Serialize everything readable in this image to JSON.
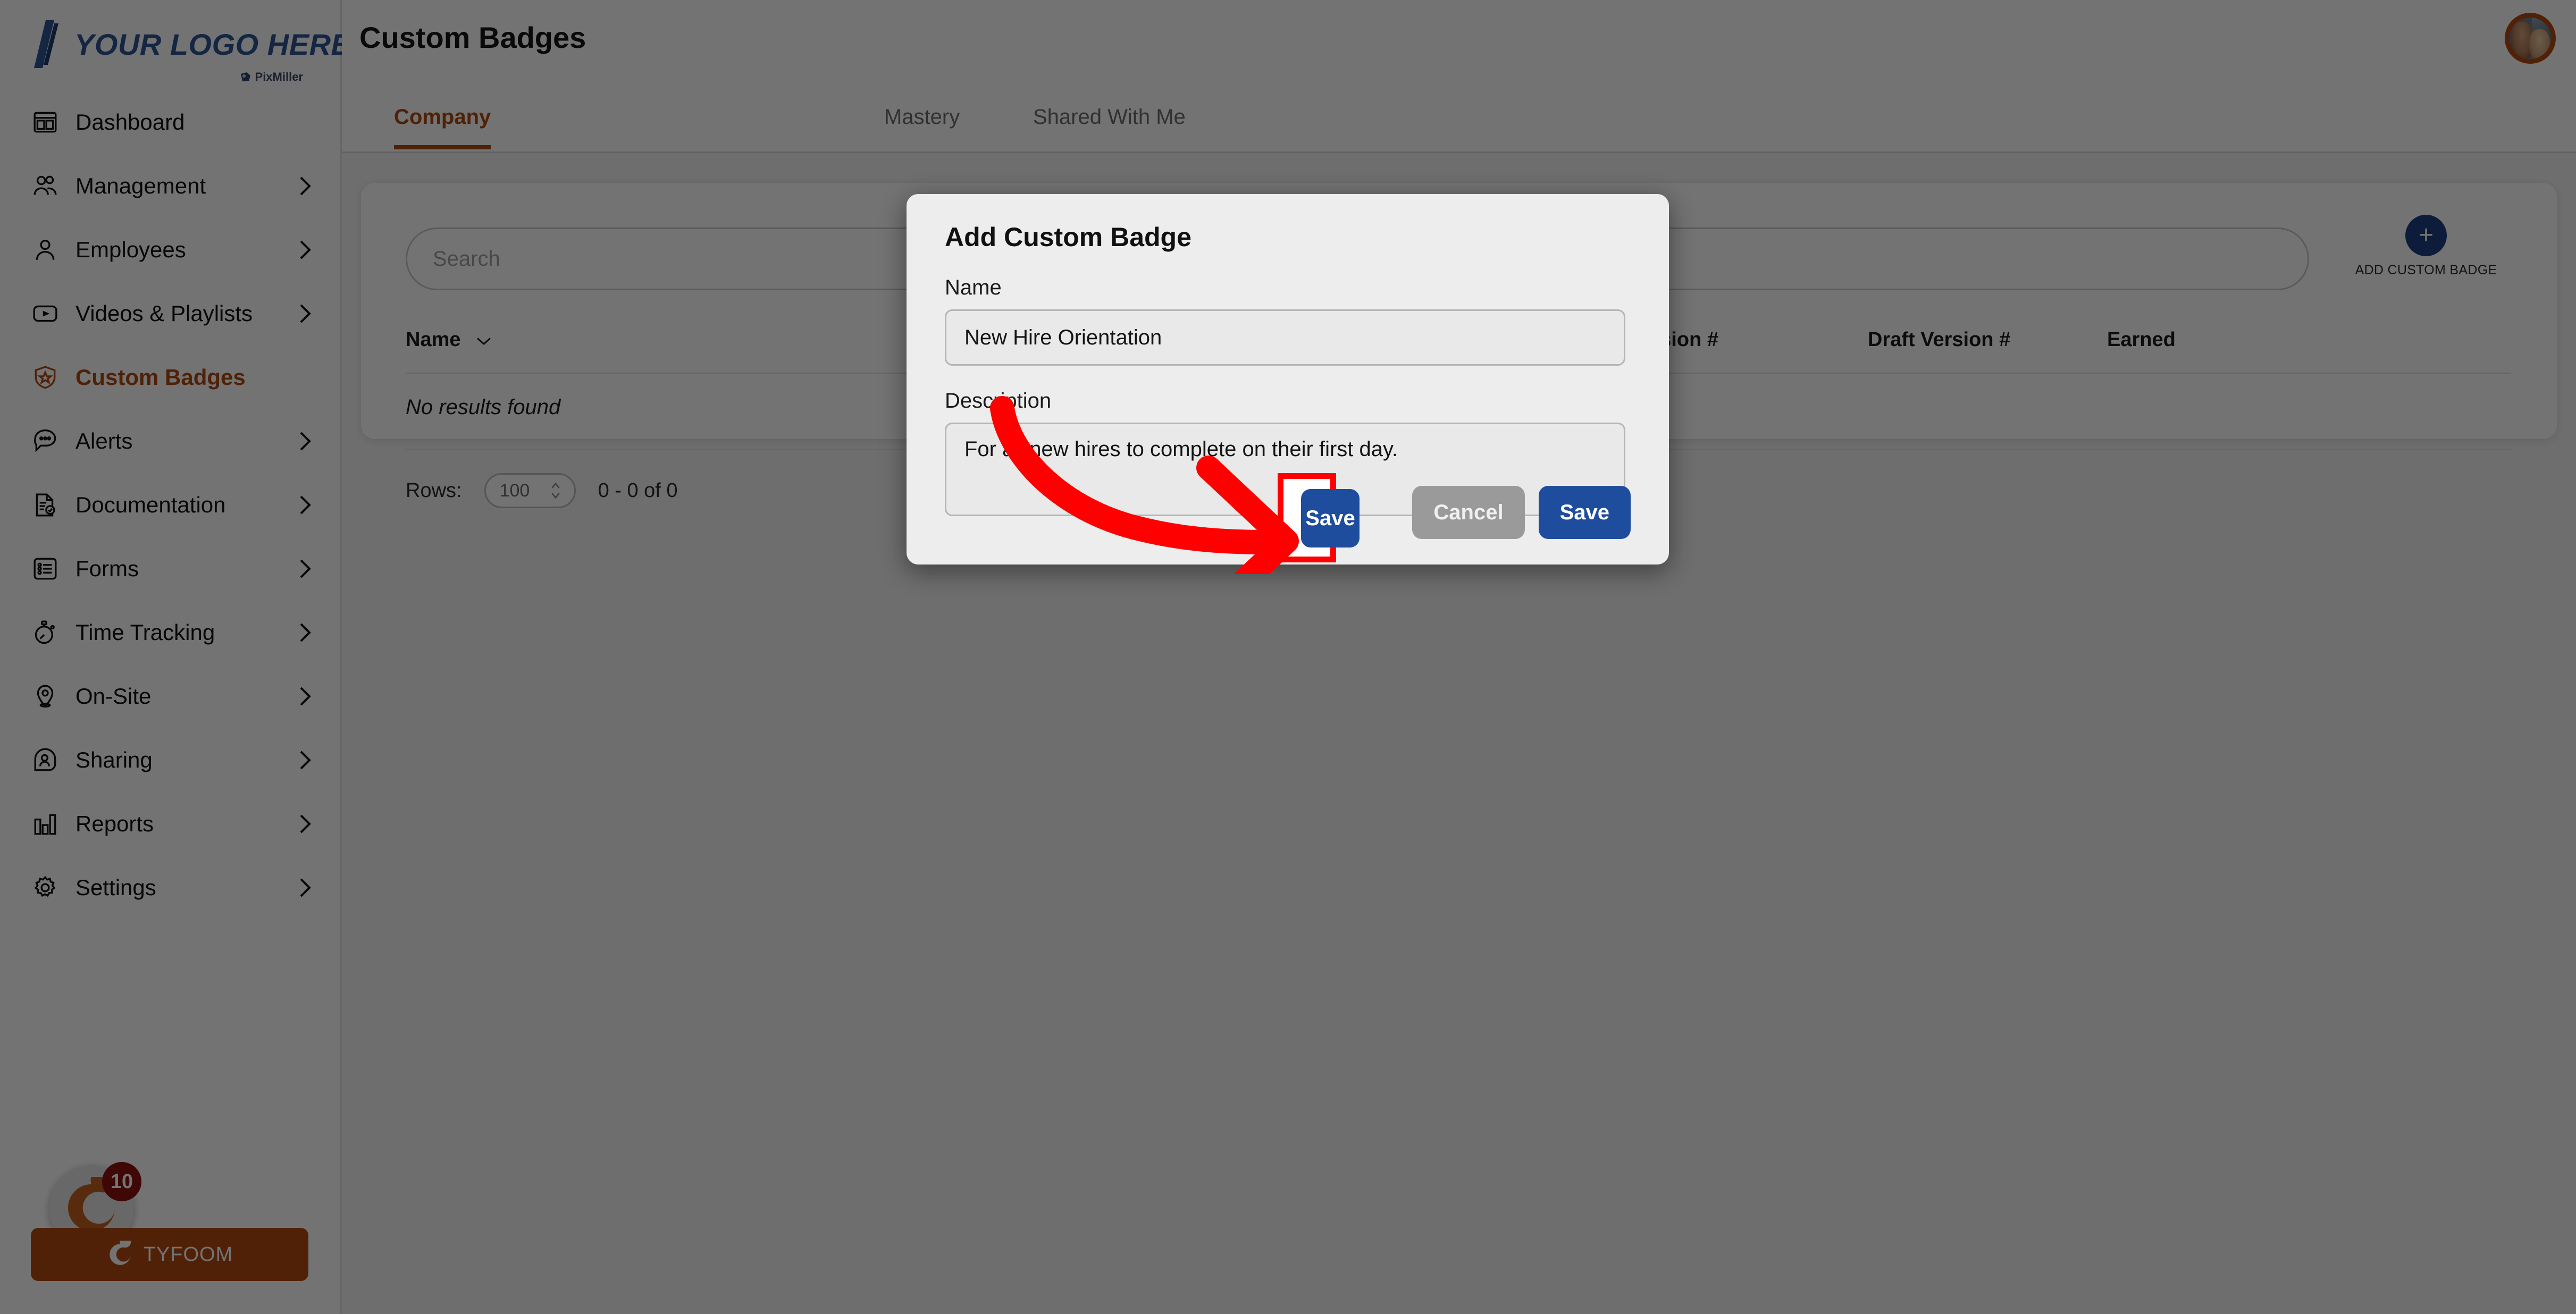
{
  "brand": {
    "logo_text": "YOUR LOGO HERE",
    "watermark": "PixMiller",
    "accent_color": "#b04a10",
    "logo_color": "#2f5596",
    "primary_button_color": "#1f4d9e",
    "highlight_color": "#ff0000"
  },
  "header": {
    "page_title": "Custom Badges"
  },
  "sidebar": {
    "items": [
      {
        "label": "Dashboard",
        "icon": "dashboard-icon",
        "has_chevron": false,
        "active": false
      },
      {
        "label": "Management",
        "icon": "people-icon",
        "has_chevron": true,
        "active": false
      },
      {
        "label": "Employees",
        "icon": "person-icon",
        "has_chevron": true,
        "active": false
      },
      {
        "label": "Videos & Playlists",
        "icon": "video-play-icon",
        "has_chevron": true,
        "active": false
      },
      {
        "label": "Custom Badges",
        "icon": "shield-star-icon",
        "has_chevron": false,
        "active": true
      },
      {
        "label": "Alerts",
        "icon": "chat-bubble-icon",
        "has_chevron": true,
        "active": false
      },
      {
        "label": "Documentation",
        "icon": "document-check-icon",
        "has_chevron": true,
        "active": false
      },
      {
        "label": "Forms",
        "icon": "form-list-icon",
        "has_chevron": true,
        "active": false
      },
      {
        "label": "Time Tracking",
        "icon": "stopwatch-icon",
        "has_chevron": true,
        "active": false
      },
      {
        "label": "On-Site",
        "icon": "map-pin-icon",
        "has_chevron": true,
        "active": false
      },
      {
        "label": "Sharing",
        "icon": "share-person-icon",
        "has_chevron": true,
        "active": false
      },
      {
        "label": "Reports",
        "icon": "bar-chart-icon",
        "has_chevron": true,
        "active": false
      },
      {
        "label": "Settings",
        "icon": "gear-icon",
        "has_chevron": true,
        "active": false
      }
    ],
    "footer": {
      "brand_label": "TYFOOM",
      "notification_count": "10"
    }
  },
  "tabs": [
    {
      "label": "Company",
      "active": true
    },
    {
      "label": "Mastery",
      "active": false
    },
    {
      "label": "Shared With Me",
      "active": false
    }
  ],
  "toolbar": {
    "search_placeholder": "Search",
    "search_value": "",
    "add_badge_label": "ADD CUSTOM BADGE",
    "add_badge_icon": "plus-icon"
  },
  "table": {
    "columns": [
      "Name",
      "Version #",
      "Draft Version #",
      "Earned"
    ],
    "sort_column": "Name",
    "sort_icon": "chevron-down-icon",
    "empty_message": "No results found",
    "rows": []
  },
  "pagination": {
    "rows_label": "Rows:",
    "rows_per_page": "100",
    "stepper_icon": "stepper-updown-icon",
    "range_label": "0 - 0 of 0"
  },
  "modal": {
    "title": "Add Custom Badge",
    "name_label": "Name",
    "name_value": "New Hire Orientation",
    "description_label": "Description",
    "description_value": "For all new hires to complete on their first day.",
    "cancel_label": "Cancel",
    "save_label": "Save"
  },
  "annotation": {
    "arrow_color": "#ff0000",
    "target": "save-button"
  }
}
